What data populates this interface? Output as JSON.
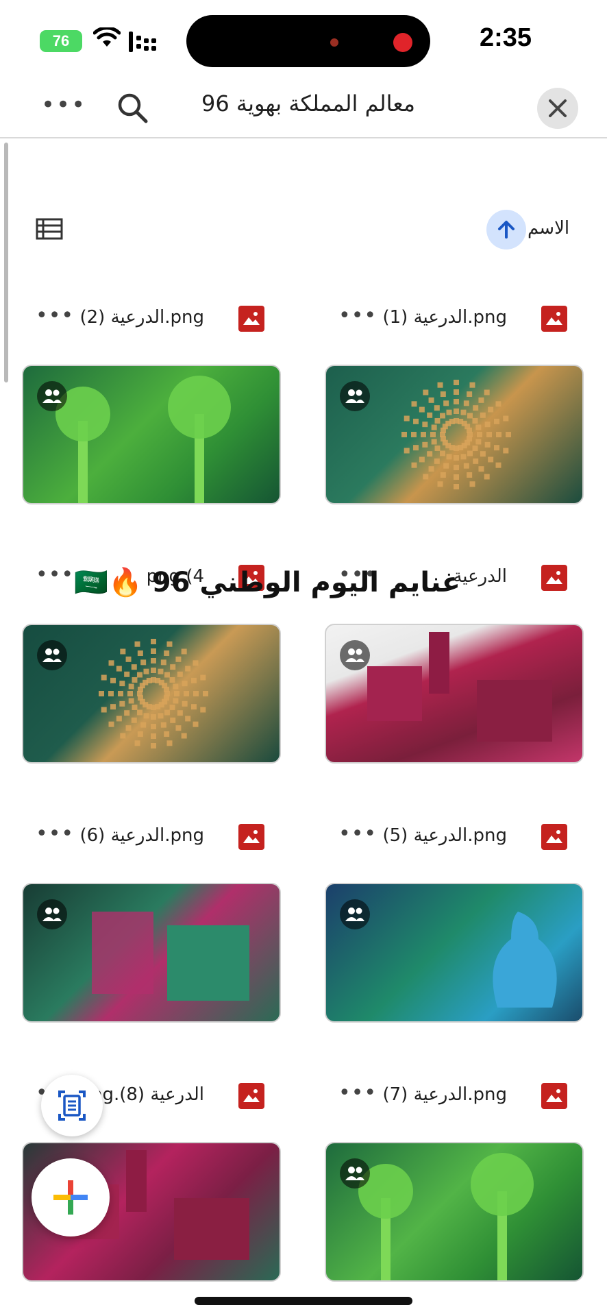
{
  "status_bar": {
    "time": "2:35",
    "battery": "76"
  },
  "header": {
    "title": "معالم المملكة بهوية 96"
  },
  "sort": {
    "label": "الاسم",
    "direction": "ascending"
  },
  "files": [
    {
      "name": "الدرعية (1).png",
      "shared": true
    },
    {
      "name": "الدرعية (2).png",
      "shared": true
    },
    {
      "name": "الدرعية",
      "shared": true
    },
    {
      "name": "png.(4",
      "shared": true
    },
    {
      "name": "الدرعية (5).png",
      "shared": true
    },
    {
      "name": "الدرعية (6).png",
      "shared": true
    },
    {
      "name": "الدرعية (7).png",
      "shared": true
    },
    {
      "name": "ng.(8) الدرعية",
      "shared": false
    }
  ],
  "overlay": {
    "text": "غنايم اليوم الوطني 96 🔥🇸🇦"
  },
  "colors": {
    "image_icon": "#c5221f",
    "sort_chip": "#d3e3fd",
    "accent_blue": "#1a57c4"
  },
  "icons": {
    "close": "close-icon",
    "search": "search-icon",
    "more": "more-horiz-icon",
    "list_view": "list-view-icon",
    "sort_arrow": "arrow-up-icon",
    "file_type": "image-file-icon",
    "shared": "shared-people-icon",
    "scan": "document-scan-icon",
    "add": "add-plus-icon"
  }
}
